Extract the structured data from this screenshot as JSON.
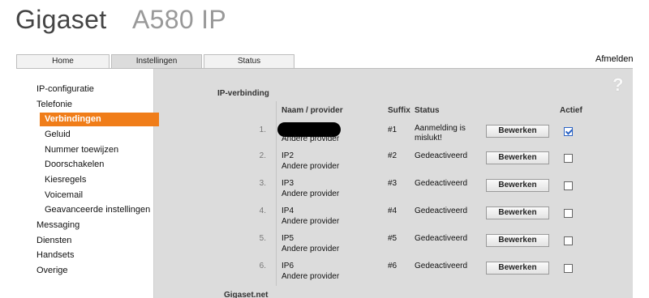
{
  "brand": {
    "name": "Gigaset",
    "model": "A580 IP"
  },
  "tabs": [
    {
      "label": "Home",
      "active": false
    },
    {
      "label": "Instellingen",
      "active": true
    },
    {
      "label": "Status",
      "active": false
    }
  ],
  "logout_label": "Afmelden",
  "help_icon": "?",
  "sidebar": {
    "items": [
      {
        "label": "IP-configuratie",
        "level": 1,
        "selected": false
      },
      {
        "label": "Telefonie",
        "level": 1,
        "selected": false
      },
      {
        "label": "Verbindingen",
        "level": 2,
        "selected": true
      },
      {
        "label": "Geluid",
        "level": 2,
        "selected": false
      },
      {
        "label": "Nummer toewijzen",
        "level": 2,
        "selected": false
      },
      {
        "label": "Doorschakelen",
        "level": 2,
        "selected": false
      },
      {
        "label": "Kiesregels",
        "level": 2,
        "selected": false
      },
      {
        "label": "Voicemail",
        "level": 2,
        "selected": false
      },
      {
        "label": "Geavanceerde instellingen",
        "level": 2,
        "selected": false
      },
      {
        "label": "Messaging",
        "level": 1,
        "selected": false
      },
      {
        "label": "Diensten",
        "level": 1,
        "selected": false
      },
      {
        "label": "Handsets",
        "level": 1,
        "selected": false
      },
      {
        "label": "Overige",
        "level": 1,
        "selected": false
      }
    ]
  },
  "section": {
    "title": "IP-verbinding",
    "headers": {
      "name": "Naam / provider",
      "suffix": "Suffix",
      "status": "Status",
      "active": "Actief"
    },
    "rows": [
      {
        "num": "1.",
        "name": "",
        "redacted": true,
        "provider": "Andere provider",
        "suffix": "#1",
        "status": "Aanmelding is mislukt!",
        "button": "Bewerken",
        "active": true
      },
      {
        "num": "2.",
        "name": "IP2",
        "redacted": false,
        "provider": "Andere provider",
        "suffix": "#2",
        "status": "Gedeactiveerd",
        "button": "Bewerken",
        "active": false
      },
      {
        "num": "3.",
        "name": "IP3",
        "redacted": false,
        "provider": "Andere provider",
        "suffix": "#3",
        "status": "Gedeactiveerd",
        "button": "Bewerken",
        "active": false
      },
      {
        "num": "4.",
        "name": "IP4",
        "redacted": false,
        "provider": "Andere provider",
        "suffix": "#4",
        "status": "Gedeactiveerd",
        "button": "Bewerken",
        "active": false
      },
      {
        "num": "5.",
        "name": "IP5",
        "redacted": false,
        "provider": "Andere provider",
        "suffix": "#5",
        "status": "Gedeactiveerd",
        "button": "Bewerken",
        "active": false
      },
      {
        "num": "6.",
        "name": "IP6",
        "redacted": false,
        "provider": "Andere provider",
        "suffix": "#6",
        "status": "Gedeactiveerd",
        "button": "Bewerken",
        "active": false
      }
    ]
  },
  "footer_section_title": "Gigaset.net",
  "colors": {
    "accent": "#f07d19",
    "panel": "#dcdcdc",
    "check": "#2b63c4"
  }
}
